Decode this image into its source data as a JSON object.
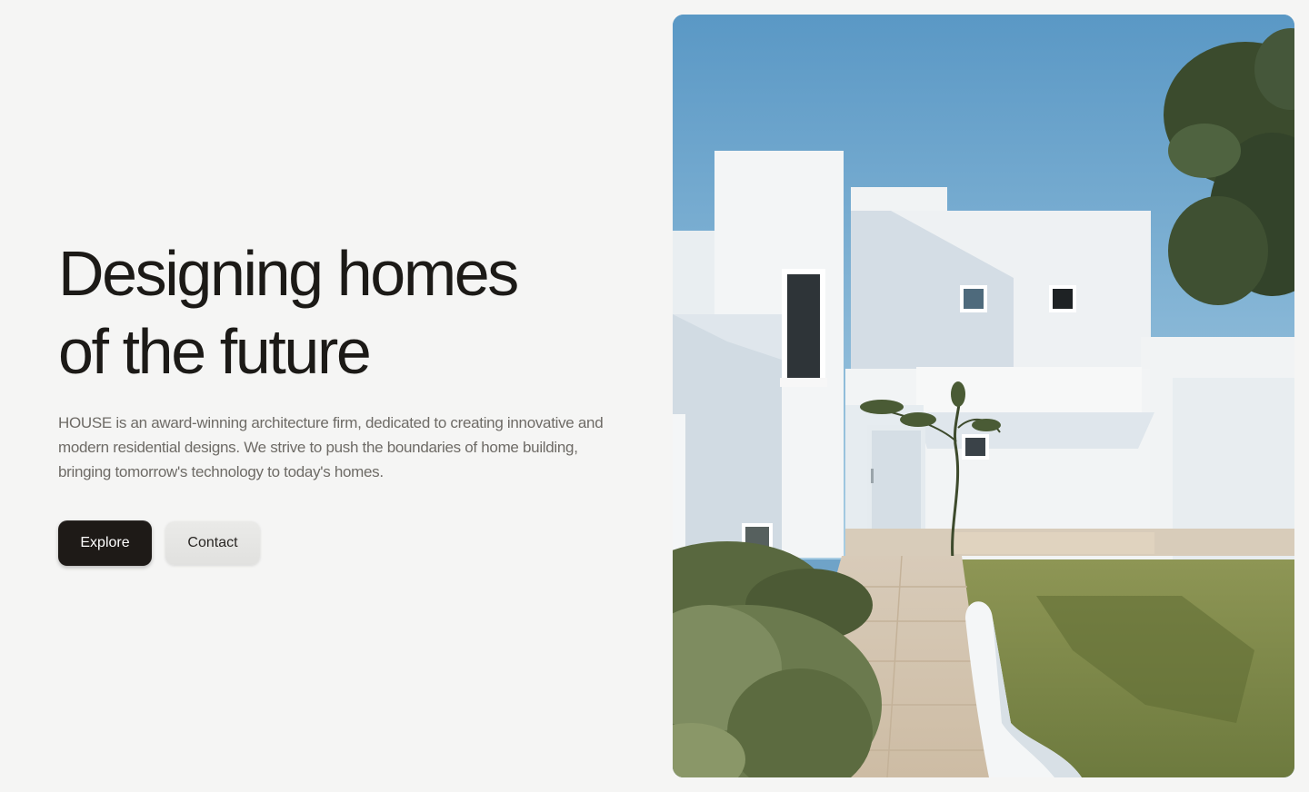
{
  "hero": {
    "title_line1": "Designing homes",
    "title_line2": "of the future",
    "description": "HOUSE is an award-winning architecture firm, dedicated to creating innovative and modern residential designs. We strive to push the boundaries of home building, bringing tomorrow's technology to today's homes.",
    "actions": {
      "explore_label": "Explore",
      "contact_label": "Contact"
    }
  },
  "image": {
    "subject": "white modern house photo",
    "colors": {
      "sky_top": "#5d9bc7",
      "sky_bottom": "#a9cde2",
      "wall": "#f4f6f7",
      "wall_shadow": "#d3dde6",
      "grass": "#7f8a4a",
      "path": "#d9c9b3",
      "tree": "#3a4a2c"
    }
  },
  "colors": {
    "background": "#f5f5f4",
    "primary_button": "#1e1a17",
    "secondary_button": "#e4e4e2",
    "text": "#1c1a17",
    "muted_text": "#6e6b66"
  }
}
